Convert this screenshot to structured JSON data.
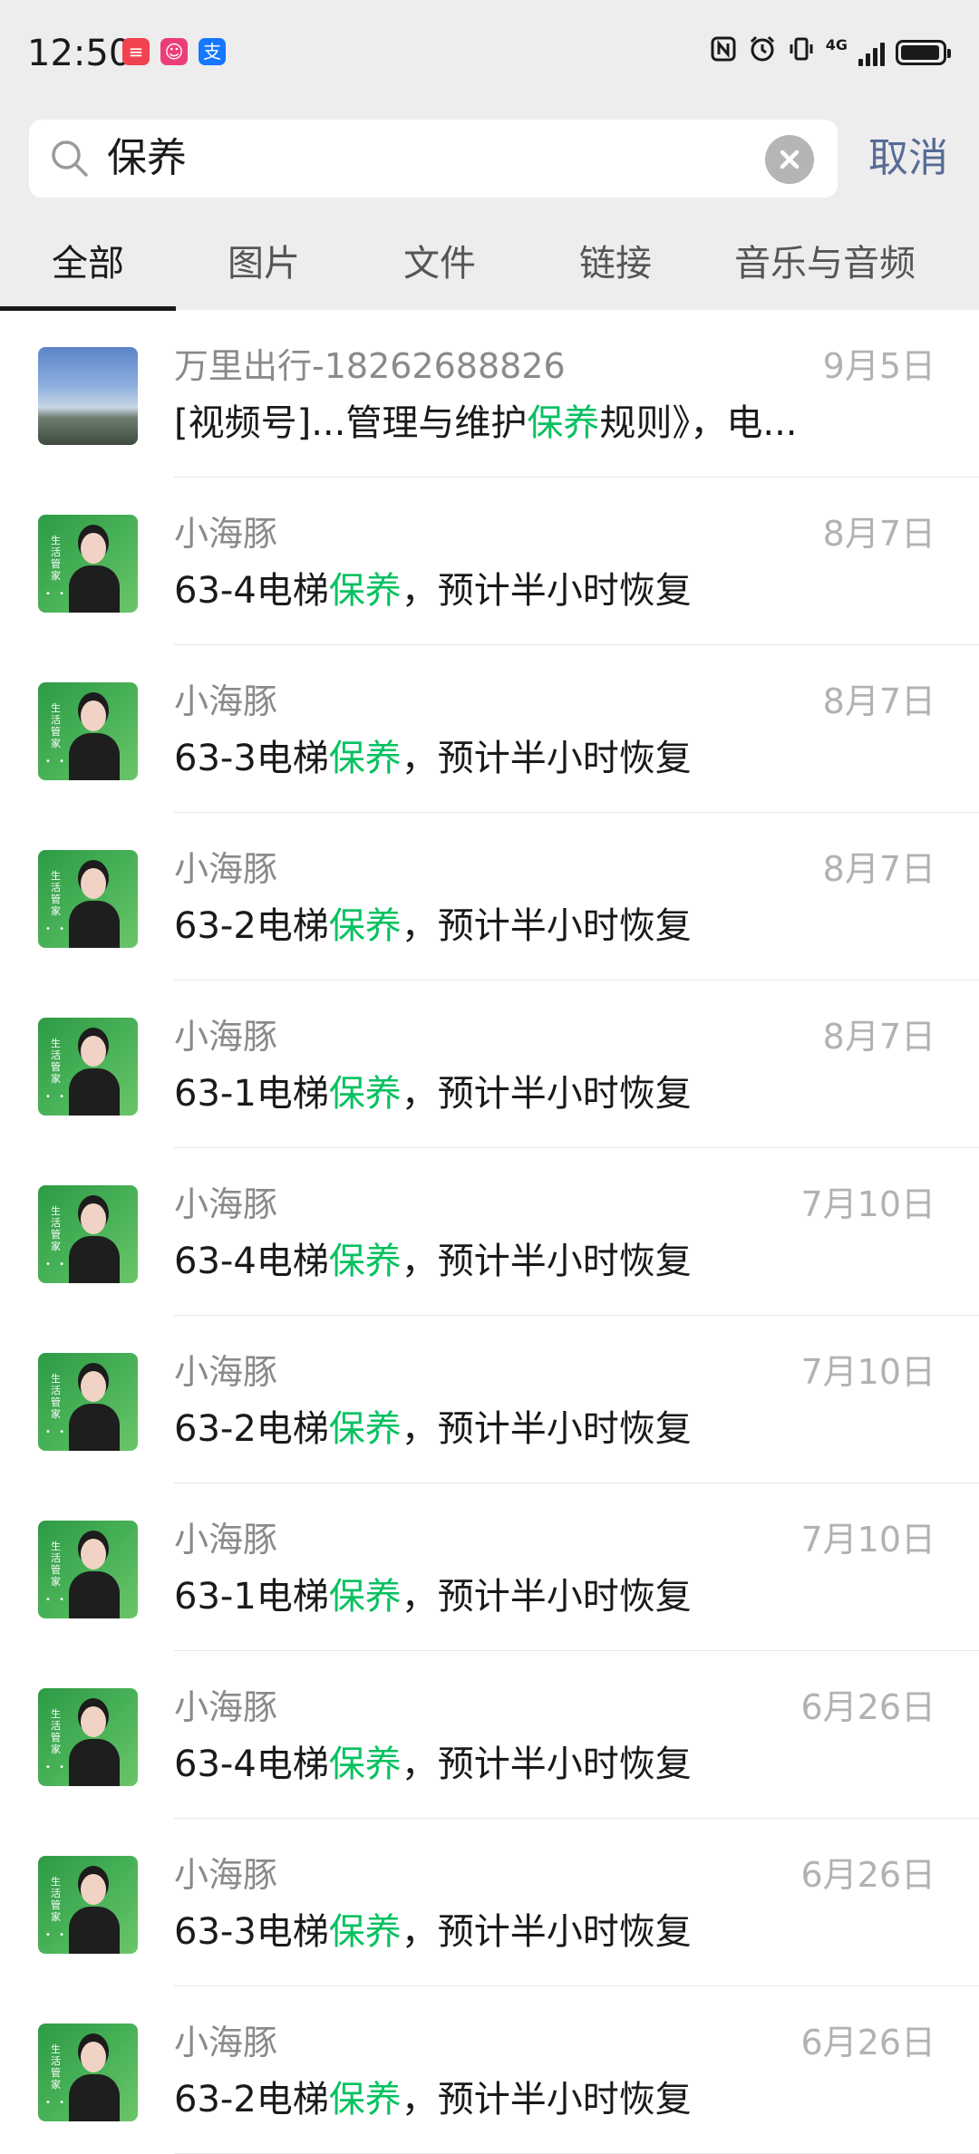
{
  "status_bar": {
    "time": "12:50",
    "badges": [
      "≡",
      "☺",
      "支"
    ],
    "network": "4G",
    "icons": [
      "nfc-icon",
      "alarm-icon",
      "vibrate-icon",
      "signal-icon",
      "battery-icon"
    ],
    "battery_level": 0.95
  },
  "search": {
    "query": "保养",
    "cancel_label": "取消"
  },
  "tabs": [
    {
      "label": "全部",
      "active": true
    },
    {
      "label": "图片",
      "active": false
    },
    {
      "label": "文件",
      "active": false
    },
    {
      "label": "链接",
      "active": false
    },
    {
      "label": "音乐与音频",
      "active": false
    }
  ],
  "avatar_text": {
    "tag": "生活管家",
    "dots": "• •"
  },
  "results": [
    {
      "sender": "万里出行-18262688826",
      "date": "9月5日",
      "pre": "[视频号]...管理与维护",
      "highlight": "保养",
      "post": "规则》，电...",
      "avatar": "landscape"
    },
    {
      "sender": "小海豚",
      "date": "8月7日",
      "pre": "63-4电梯",
      "highlight": "保养",
      "post": "，预计半小时恢复",
      "avatar": "agent"
    },
    {
      "sender": "小海豚",
      "date": "8月7日",
      "pre": "63-3电梯",
      "highlight": "保养",
      "post": "，预计半小时恢复",
      "avatar": "agent"
    },
    {
      "sender": "小海豚",
      "date": "8月7日",
      "pre": "63-2电梯",
      "highlight": "保养",
      "post": "，预计半小时恢复",
      "avatar": "agent"
    },
    {
      "sender": "小海豚",
      "date": "8月7日",
      "pre": "63-1电梯",
      "highlight": "保养",
      "post": "，预计半小时恢复",
      "avatar": "agent"
    },
    {
      "sender": "小海豚",
      "date": "7月10日",
      "pre": "63-4电梯",
      "highlight": "保养",
      "post": "，预计半小时恢复",
      "avatar": "agent"
    },
    {
      "sender": "小海豚",
      "date": "7月10日",
      "pre": "63-2电梯",
      "highlight": "保养",
      "post": "，预计半小时恢复",
      "avatar": "agent"
    },
    {
      "sender": "小海豚",
      "date": "7月10日",
      "pre": "63-1电梯",
      "highlight": "保养",
      "post": "，预计半小时恢复",
      "avatar": "agent"
    },
    {
      "sender": "小海豚",
      "date": "6月26日",
      "pre": "63-4电梯",
      "highlight": "保养",
      "post": "，预计半小时恢复",
      "avatar": "agent"
    },
    {
      "sender": "小海豚",
      "date": "6月26日",
      "pre": "63-3电梯",
      "highlight": "保养",
      "post": "，预计半小时恢复",
      "avatar": "agent"
    },
    {
      "sender": "小海豚",
      "date": "6月26日",
      "pre": "63-2电梯",
      "highlight": "保养",
      "post": "，预计半小时恢复",
      "avatar": "agent"
    }
  ]
}
